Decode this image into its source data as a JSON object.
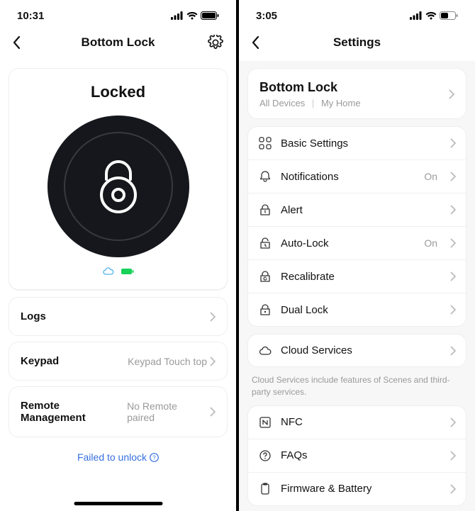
{
  "left": {
    "status": {
      "time": "10:31"
    },
    "title": "Bottom Lock",
    "state": "Locked",
    "rows": {
      "logs": {
        "label": "Logs"
      },
      "keypad": {
        "label": "Keypad",
        "value": "Keypad Touch top"
      },
      "remote": {
        "label": "Remote Management",
        "value": "No Remote paired"
      }
    },
    "warning": "Failed to unlock"
  },
  "right": {
    "status": {
      "time": "3:05"
    },
    "title": "Settings",
    "device": {
      "name": "Bottom Lock",
      "breadcrumb1": "All Devices",
      "breadcrumb2": "My Home"
    },
    "group1": [
      {
        "id": "basic",
        "label": "Basic Settings",
        "value": ""
      },
      {
        "id": "notifications",
        "label": "Notifications",
        "value": "On"
      },
      {
        "id": "alert",
        "label": "Alert",
        "value": ""
      },
      {
        "id": "autolock",
        "label": "Auto-Lock",
        "value": "On"
      },
      {
        "id": "recalibrate",
        "label": "Recalibrate",
        "value": ""
      },
      {
        "id": "duallock",
        "label": "Dual Lock",
        "value": ""
      }
    ],
    "group2": [
      {
        "id": "cloud",
        "label": "Cloud Services",
        "value": ""
      }
    ],
    "cloud_note": "Cloud Services include features of Scenes and third-party services.",
    "group3": [
      {
        "id": "nfc",
        "label": "NFC",
        "value": ""
      },
      {
        "id": "faqs",
        "label": "FAQs",
        "value": ""
      },
      {
        "id": "firmware",
        "label": "Firmware & Battery",
        "value": ""
      }
    ]
  }
}
